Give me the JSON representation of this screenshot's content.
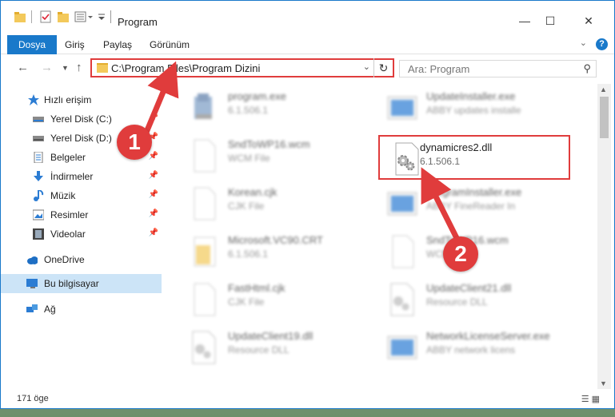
{
  "window": {
    "title": "Program",
    "controls": {
      "minimize": "—",
      "maximize": "☐",
      "close": "✕"
    }
  },
  "ribbon": {
    "tabs": [
      "Dosya",
      "Giriş",
      "Paylaş",
      "Görünüm"
    ],
    "help": "?"
  },
  "navigation": {
    "address_path": "C:\\Program Files\\Program Dizini",
    "search_placeholder": "Ara: Program"
  },
  "sidebar": {
    "items": [
      {
        "label": "Hızlı erişim",
        "icon": "star-icon",
        "pinned": false
      },
      {
        "label": "Yerel Disk (C:)",
        "icon": "drive-icon",
        "pinned": true
      },
      {
        "label": "Yerel Disk (D:)",
        "icon": "drive-icon",
        "pinned": true
      },
      {
        "label": "Belgeler",
        "icon": "documents-icon",
        "pinned": true
      },
      {
        "label": "İndirmeler",
        "icon": "downloads-icon",
        "pinned": true
      },
      {
        "label": "Müzik",
        "icon": "music-icon",
        "pinned": true
      },
      {
        "label": "Resimler",
        "icon": "pictures-icon",
        "pinned": true
      },
      {
        "label": "Videolar",
        "icon": "videos-icon",
        "pinned": true
      },
      {
        "label": "OneDrive",
        "icon": "cloud-icon",
        "pinned": false
      },
      {
        "label": "Bu bilgisayar",
        "icon": "computer-icon",
        "pinned": false,
        "selected": true
      },
      {
        "label": "Ağ",
        "icon": "network-icon",
        "pinned": false
      }
    ]
  },
  "files": [
    {
      "name": "program.exe",
      "sub": "6.1.506.1",
      "icon": "installer-icon"
    },
    {
      "name": "UpdateInstaller.exe",
      "sub": "ABBY updates installe",
      "icon": "app-window-icon"
    },
    {
      "name": "SndToWP16.wcm",
      "sub": "WCM File",
      "icon": "blank-file-icon"
    },
    {
      "name": "dynamicres2.dll",
      "sub": "6.1.506.1",
      "icon": "dll-gear-icon",
      "highlighted": true
    },
    {
      "name": "Korean.cjk",
      "sub": "CJK File",
      "icon": "blank-file-icon"
    },
    {
      "name": "ProgramInstaller.exe",
      "sub": "ABBY FineReader In",
      "icon": "app-window-icon"
    },
    {
      "name": "Microsoft.VC90.CRT",
      "sub": "6.1.506.1",
      "icon": "folder-file-icon"
    },
    {
      "name": "SndToWP16.wcm",
      "sub": "WCM File",
      "icon": "blank-file-icon"
    },
    {
      "name": "FastHtml.cjk",
      "sub": "CJK File",
      "icon": "blank-file-icon"
    },
    {
      "name": "UpdateClient21.dll",
      "sub": "Resource DLL",
      "icon": "dll-gear-icon"
    },
    {
      "name": "UpdateClient19.dll",
      "sub": "Resource DLL",
      "icon": "dll-gear-icon"
    },
    {
      "name": "NetworkLicenseServer.exe",
      "sub": "ABBY network licens",
      "icon": "app-window-icon"
    }
  ],
  "status": {
    "item_count": "171 öge"
  },
  "callouts": [
    {
      "number": "1"
    },
    {
      "number": "2"
    }
  ],
  "colors": {
    "accent": "#1979ca",
    "callout": "#e03c3c",
    "selection": "#cce4f7"
  }
}
